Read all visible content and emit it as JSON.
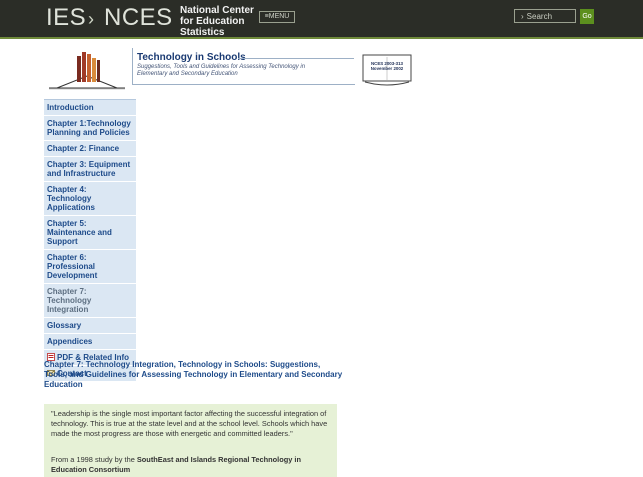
{
  "header": {
    "logo_ies": "IES",
    "logo_nces": "NCES",
    "center_name": "National Center for Education Statistics",
    "menu_label": "MENU",
    "search_placeholder": "Search",
    "go_label": "Go",
    "colors": {
      "bar": "#2b2d27",
      "accent": "#6f8a3a",
      "go": "#5c8f1e"
    }
  },
  "publication": {
    "title": "Technology in Schools",
    "subtitle": "Suggestions, Tools and Guidelines for Assessing Technology in Elementary and Secondary Education",
    "badge_line1": "NCES 2003-313",
    "badge_line2": "November 2002"
  },
  "nav": {
    "items": [
      {
        "label": "Introduction"
      },
      {
        "label": "Chapter 1:Technology Planning and Policies"
      },
      {
        "label": "Chapter 2: Finance"
      },
      {
        "label": "Chapter 3: Equipment and Infrastructure"
      },
      {
        "label": "Chapter 4: Technology Applications"
      },
      {
        "label": "Chapter 5: Maintenance and Support"
      },
      {
        "label": "Chapter 6: Professional Development"
      },
      {
        "label": "Chapter 7: Technology Integration"
      },
      {
        "label": "Glossary"
      },
      {
        "label": "Appendices"
      },
      {
        "label": "PDF & Related Info",
        "icon": "pdf-icon"
      },
      {
        "label": "Contact",
        "icon": "mail-icon"
      }
    ],
    "colors": {
      "bg": "#dbe7f3",
      "link": "#1e4b8a",
      "active": "#5d6f82"
    }
  },
  "content": {
    "heading": "Chapter 7: Technology Integration, Technology in Schools: Suggestions, Tools, and Guidelines for Assessing Technology in Elementary and Secondary Education",
    "quote": "\"Leadership is the single most important factor affecting the successful integration of technology. This is true at the state level and at the school level. Schools which have made the most progress are those with energetic and committed leaders.\"",
    "source_prefix": "From a 1998 study by the ",
    "source_org": "SouthEast and Islands Regional Technology in Education Consortium",
    "colors": {
      "quote_bg": "#e6f1d6"
    }
  }
}
